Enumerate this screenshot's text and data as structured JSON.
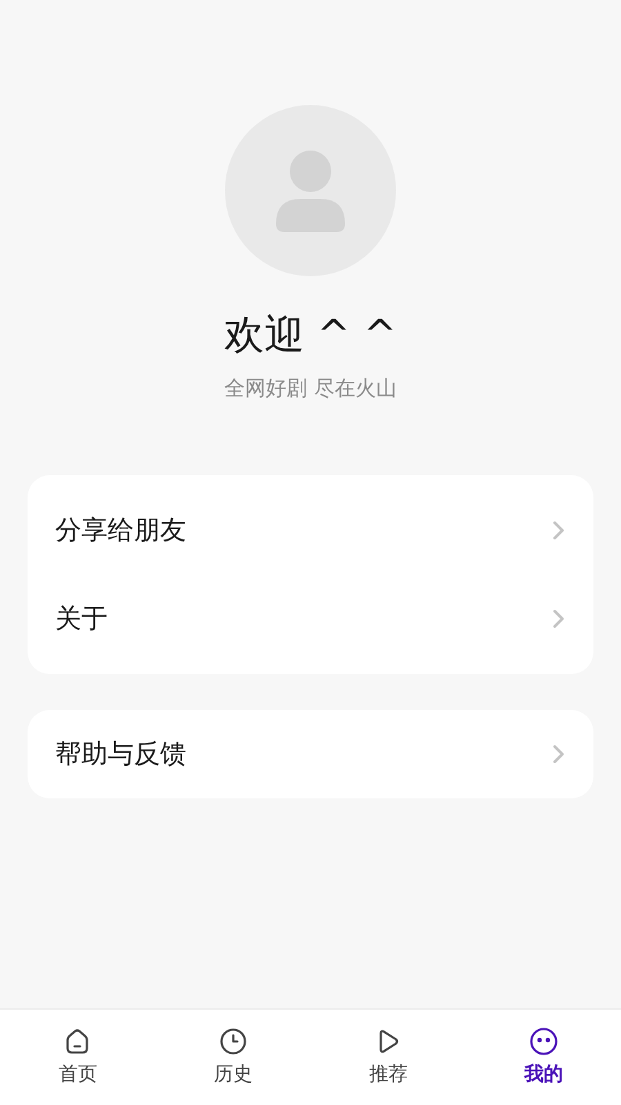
{
  "profile": {
    "title": "欢迎 ^ ^",
    "subtitle": "全网好剧 尽在火山"
  },
  "menu_groups": [
    {
      "items": [
        {
          "label": "分享给朋友"
        },
        {
          "label": "关于"
        }
      ]
    },
    {
      "items": [
        {
          "label": "帮助与反馈"
        }
      ]
    }
  ],
  "tab_bar": [
    {
      "label": "首页",
      "kind": "home",
      "selected": false
    },
    {
      "label": "历史",
      "kind": "history",
      "selected": false
    },
    {
      "label": "推荐",
      "kind": "play",
      "selected": false
    },
    {
      "label": "我的",
      "kind": "face",
      "selected": true
    }
  ]
}
